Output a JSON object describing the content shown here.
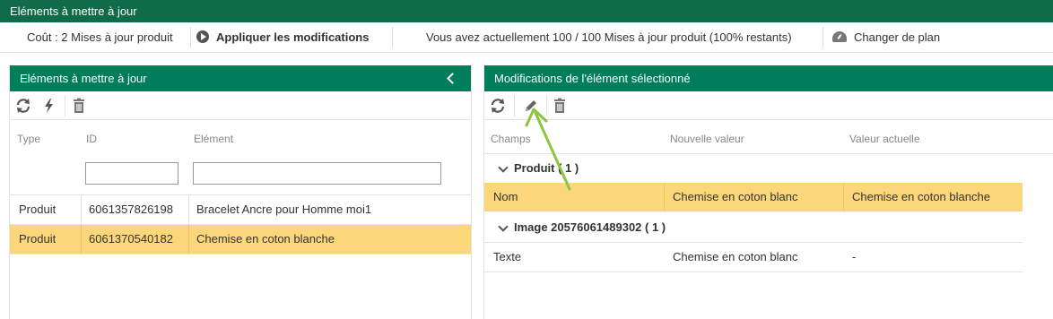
{
  "window_title": "Eléments à mettre à jour",
  "toolbar": {
    "cost": "Coût : 2 Mises à jour produit",
    "apply_label": "Appliquer les modifications",
    "quota": "Vous avez actuellement 100 / 100 Mises à jour produit (100% restants)",
    "change_plan": "Changer de plan"
  },
  "left_panel": {
    "title": "Eléments à mettre à jour",
    "columns": {
      "type": "Type",
      "id": "ID",
      "element": "Elément"
    },
    "filters": {
      "id_value": "",
      "element_value": ""
    },
    "rows": [
      {
        "type": "Produit",
        "id": "6061357826198",
        "element": "Bracelet Ancre pour Homme moi1",
        "selected": false
      },
      {
        "type": "Produit",
        "id": "6061370540182",
        "element": "Chemise en coton blanche",
        "selected": true
      }
    ]
  },
  "right_panel": {
    "title": "Modifications de l'élément sélectionné",
    "columns": {
      "field": "Champs",
      "new_value": "Nouvelle valeur",
      "current_value": "Valeur actuelle"
    },
    "groups": [
      {
        "label": "Produit ( 1 )",
        "rows": [
          {
            "field": "Nom",
            "new_value": "Chemise en coton blanc",
            "current_value": "Chemise en coton blanche",
            "selected": true
          }
        ]
      },
      {
        "label": "Image 20576061489302 ( 1 )",
        "rows": [
          {
            "field": "Texte",
            "new_value": "Chemise en coton blanc",
            "current_value": "-",
            "selected": false
          }
        ]
      }
    ]
  },
  "icons": {
    "refresh": "refresh-icon",
    "flash": "flash-icon",
    "trash": "trash-icon",
    "edit": "pencil-icon",
    "play": "play-icon",
    "gauge": "gauge-icon",
    "collapse": "chevron-left-icon"
  },
  "colors": {
    "titlebar": "#106b48",
    "panel_header": "#007d5a",
    "selected_row": "#fbd77a",
    "annotation_arrow": "#8cc63e"
  }
}
